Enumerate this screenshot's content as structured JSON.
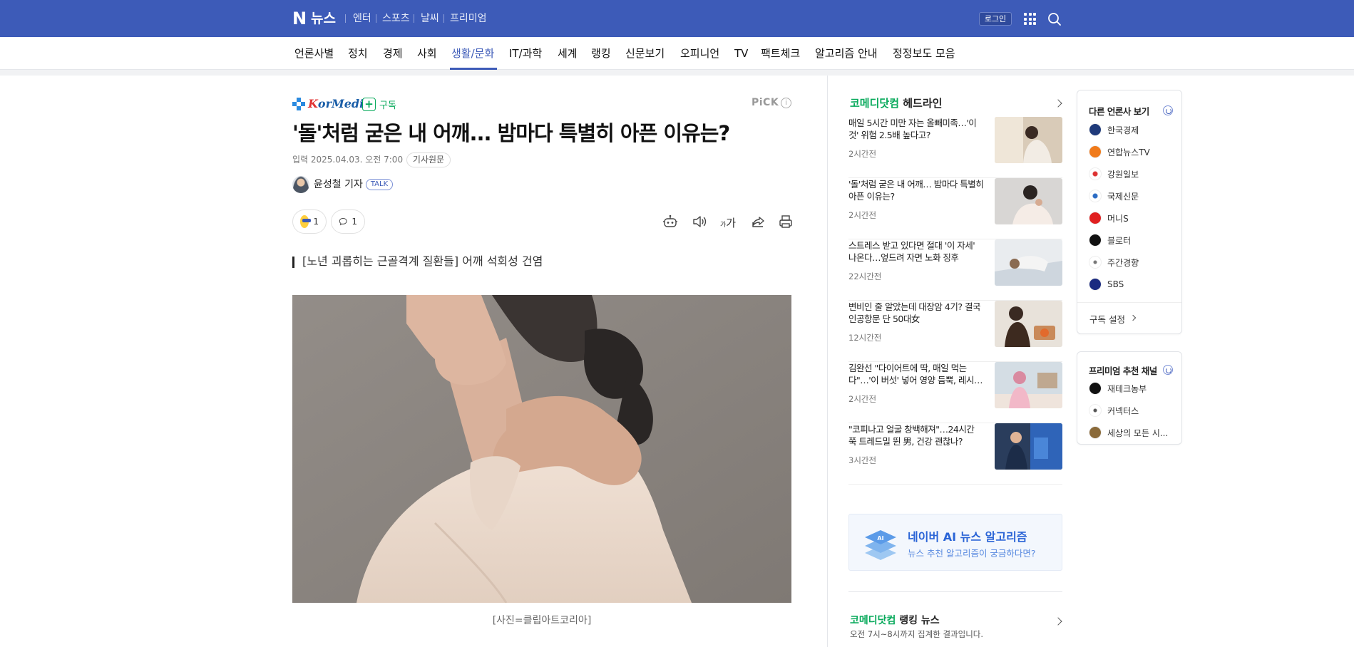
{
  "header": {
    "logo_n": "N",
    "logo_news": "뉴스",
    "services": [
      "엔터",
      "스포츠",
      "날씨",
      "프리미엄"
    ],
    "login_label": "로그인",
    "brand_color": "#3d5bb8"
  },
  "categories": [
    "언론사별",
    "정치",
    "경제",
    "사회",
    "생활/문화",
    "IT/과학",
    "세계",
    "랭킹",
    "신문보기",
    "오피니언",
    "TV",
    "팩트체크",
    "알고리즘 안내",
    "정정보도 모음"
  ],
  "active_category": "생활/문화",
  "article": {
    "press_logo_a": "K",
    "press_logo_b": "orMedi",
    "subscribe_label": "구독",
    "pick_label": "PiCK",
    "pick_info": "i",
    "headline": "'돌'처럼 굳은 내 어깨... 밤마다 특별히 아픈 이유는?",
    "date": "입력 2025.04.03. 오전 7:00",
    "original_label": "기사원문",
    "reporter": "윤성철 기자",
    "talk_label": "TALK",
    "reaction_count": "1",
    "comment_count": "1",
    "tools": [
      "robot-summary-icon",
      "audio-icon",
      "font-size-icon",
      "share-icon",
      "print-icon"
    ],
    "font_size_label": "가",
    "font_size_small": "가",
    "subtitle": "[노년 괴롭히는 근골격계 질환들] 어깨 석회성 건염",
    "caption": "[사진=클립아트코리아]"
  },
  "headline_section": {
    "brand": "코메디닷컴",
    "title": "헤드라인",
    "items": [
      {
        "title": "매일 5시간 미만 자는 올빼미족…'이것' 위험 2.5배 높다고?",
        "time": "2시간전"
      },
      {
        "title": "'돌'처럼 굳은 내 어깨… 밤마다 특별히 아픈 이유는?",
        "time": "2시간전"
      },
      {
        "title": "스트레스 받고 있다면 절대 '이 자세' 나온다…엎드려 자면 노화 징후",
        "time": "22시간전"
      },
      {
        "title": "변비인 줄 알았는데 대장암 4기? 결국 인공항문 단 50대女",
        "time": "12시간전"
      },
      {
        "title": "김완선 \"다이어트에 딱, 매일 먹는다\"…'이 버섯' 넣어 영양 듬뿍, 레시…",
        "time": "2시간전"
      },
      {
        "title": "\"코피나고 얼굴 창백해져\"…24시간 쭉 트레드밀 뛴 男, 건강 괜찮나?",
        "time": "3시간전"
      }
    ]
  },
  "ai_banner": {
    "title": "네이버 AI 뉴스 알고리즘",
    "subtitle": "뉴스 추천 알고리즘이 궁금하다면?",
    "badge": "AI"
  },
  "ranking_section": {
    "brand": "코메디닷컴",
    "title": "랭킹 뉴스",
    "subtitle": "오전 7시~8시까지 집계한 결과입니다."
  },
  "other_press": {
    "title": "다른 언론사 보기",
    "items": [
      {
        "name": "한국경제",
        "color": "#1f3a7a"
      },
      {
        "name": "연합뉴스TV",
        "color": "#f07a1a"
      },
      {
        "name": "강원일보",
        "color": "#ffffff"
      },
      {
        "name": "국제신문",
        "color": "#ffffff"
      },
      {
        "name": "머니S",
        "color": "#e02020"
      },
      {
        "name": "블로터",
        "color": "#111111"
      },
      {
        "name": "주간경향",
        "color": "#ffffff"
      },
      {
        "name": "SBS",
        "color": "#1a2a80"
      }
    ],
    "footer": "구독 설정"
  },
  "premium": {
    "title": "프리미엄 추천 채널",
    "items": [
      {
        "name": "재테크농부",
        "color": "#111111"
      },
      {
        "name": "커넥터스",
        "color": "#ffffff"
      },
      {
        "name": "세상의 모든 시...",
        "color": "#8a6a3a"
      }
    ]
  }
}
